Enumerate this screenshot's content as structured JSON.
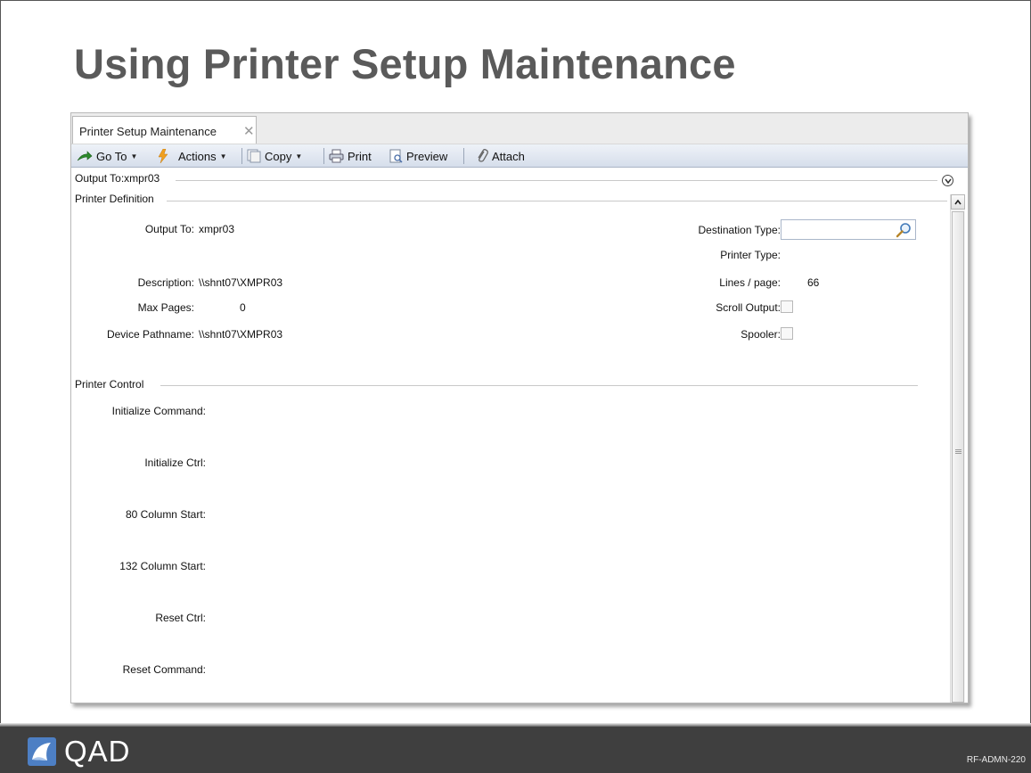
{
  "slide": {
    "title": "Using Printer Setup Maintenance",
    "code": "RF-ADMN-220",
    "logo_text": "QAD"
  },
  "tabs": [
    {
      "label": "Printer Setup Maintenance",
      "close": "✕"
    }
  ],
  "toolbar": {
    "goto_label": "Go To",
    "actions_label": "Actions",
    "copy_label": "Copy",
    "print_label": "Print",
    "preview_label": "Preview",
    "attach_label": "Attach"
  },
  "header_bar": {
    "title": "Output To:xmpr03"
  },
  "printer_definition": {
    "group_title": "Printer Definition",
    "output_to_label": "Output To:",
    "output_to_value": "xmpr03",
    "description_label": "Description:",
    "description_value": "\\\\shnt07\\XMPR03",
    "max_pages_label": "Max Pages:",
    "max_pages_value": "0",
    "device_pathname_label": "Device Pathname:",
    "device_pathname_value": "\\\\shnt07\\XMPR03",
    "destination_type_label": "Destination Type:",
    "destination_type_value": "",
    "printer_type_label": "Printer Type:",
    "printer_type_value": "",
    "lines_page_label": "Lines / page:",
    "lines_page_value": "66",
    "scroll_output_label": "Scroll Output:",
    "scroll_output_checked": false,
    "spooler_label": "Spooler:",
    "spooler_checked": false
  },
  "printer_control": {
    "group_title": "Printer Control",
    "initialize_command_label": "Initialize Command:",
    "initialize_ctrl_label": "Initialize Ctrl:",
    "col80_start_label": "80 Column Start:",
    "col132_start_label": "132 Column Start:",
    "reset_ctrl_label": "Reset Ctrl:",
    "reset_command_label": "Reset Command:"
  },
  "colors": {
    "title_gray": "#5a5a5a",
    "footer": "#3f3f3f",
    "toolbar_top": "#eef2f8",
    "toolbar_bottom": "#d6deeb"
  }
}
